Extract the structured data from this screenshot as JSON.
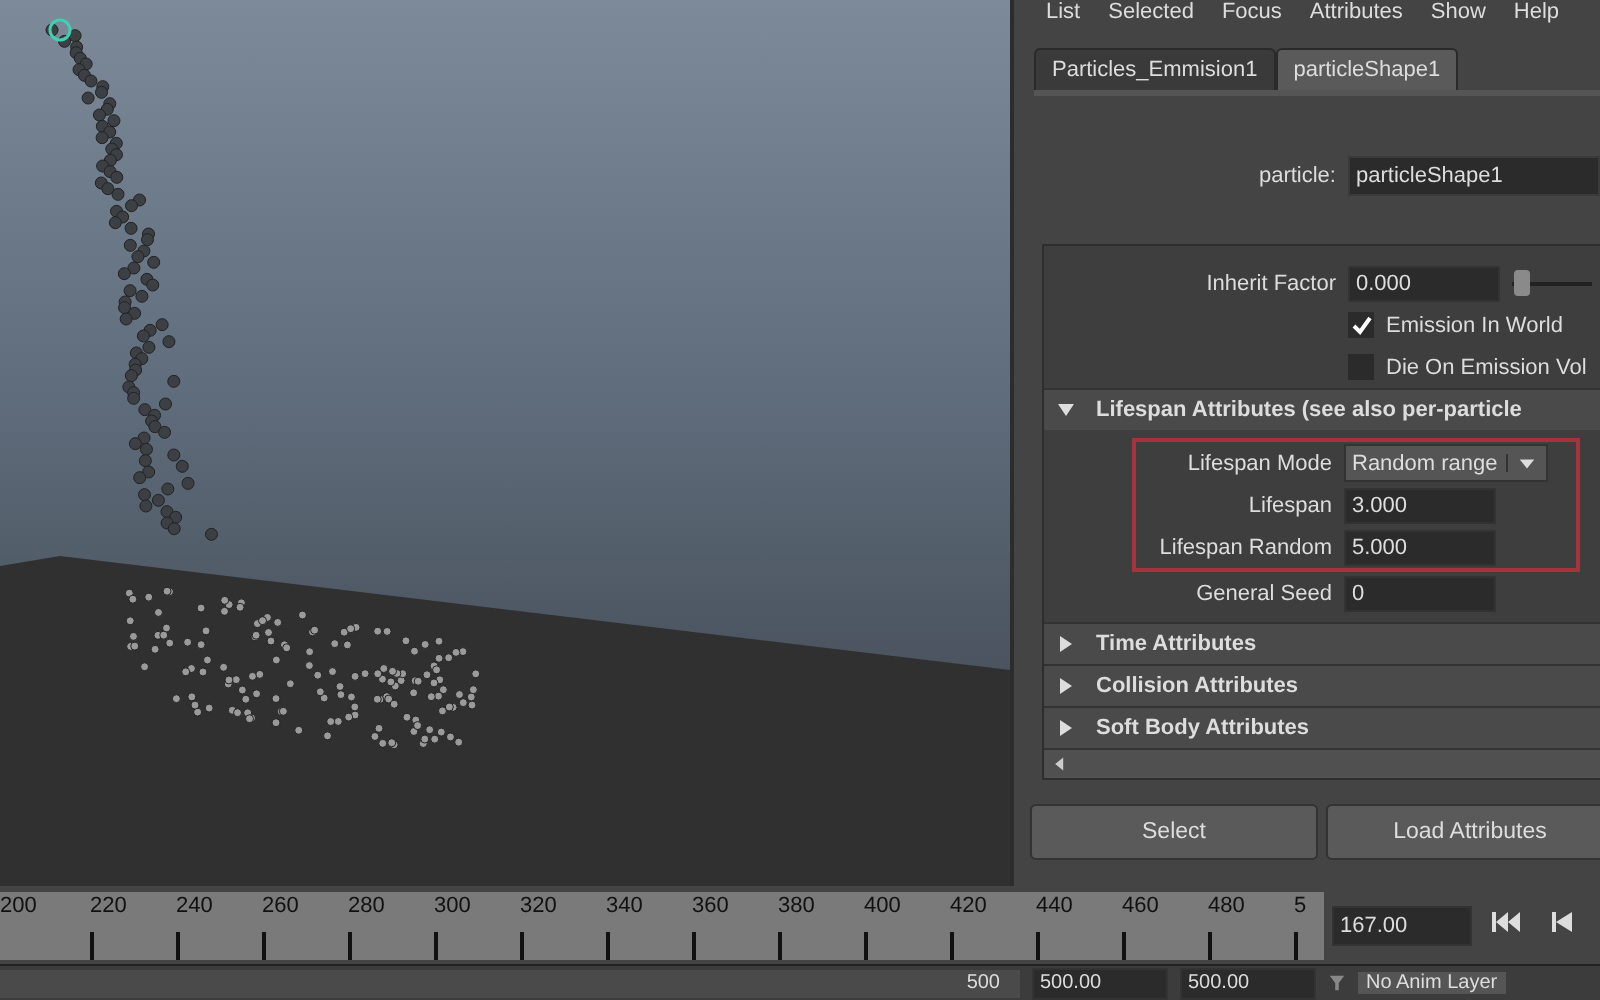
{
  "menu": [
    "List",
    "Selected",
    "Focus",
    "Attributes",
    "Show",
    "Help"
  ],
  "tabs": [
    {
      "label": "Particles_Emmision1",
      "selected": false
    },
    {
      "label": "particleShape1",
      "selected": true
    }
  ],
  "node": {
    "label": "particle:",
    "value": "particleShape1"
  },
  "top_rows": [
    {
      "kind": "slider",
      "label": "Inherit Factor",
      "value": "0.000",
      "level": 0.02
    },
    {
      "kind": "checkbox",
      "label": "Emission In World",
      "checked": true
    },
    {
      "kind": "checkbox",
      "label": "Die On Emission Vol",
      "checked": false
    }
  ],
  "sections": [
    {
      "title": "Lifespan Attributes (see also per-particle",
      "expanded": true,
      "rows": [
        {
          "kind": "dropdown",
          "label": "Lifespan Mode",
          "value": "Random range",
          "highlighted": true
        },
        {
          "kind": "field",
          "label": "Lifespan",
          "value": "3.000",
          "highlighted": true
        },
        {
          "kind": "field",
          "label": "Lifespan Random",
          "value": "5.000",
          "highlighted": true
        },
        {
          "kind": "field",
          "label": "General Seed",
          "value": "0",
          "highlighted": false
        }
      ]
    },
    {
      "title": "Time Attributes",
      "expanded": false
    },
    {
      "title": "Collision Attributes",
      "expanded": false
    },
    {
      "title": "Soft Body Attributes",
      "expanded": false
    }
  ],
  "buttons": [
    "Select",
    "Load Attributes"
  ],
  "timeline": {
    "ticks": [
      "200",
      "220",
      "240",
      "260",
      "280",
      "300",
      "320",
      "340",
      "360",
      "380",
      "400",
      "420",
      "440",
      "460",
      "480",
      "5"
    ],
    "current_frame": "167.00"
  },
  "range_bar": {
    "end": "500",
    "start_field": "500.00",
    "end_field": "500.00",
    "anim_layer": "No Anim Layer"
  }
}
